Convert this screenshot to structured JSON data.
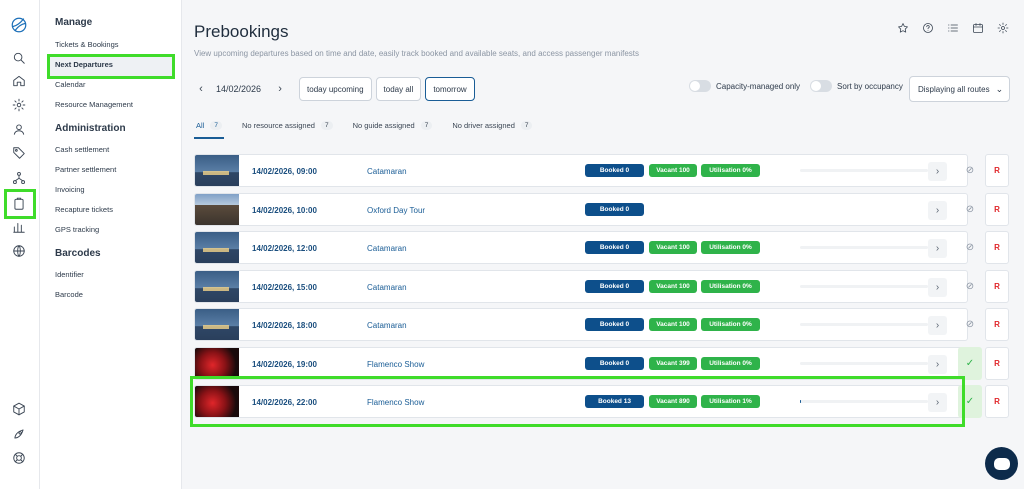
{
  "nav": {
    "sections": [
      {
        "title": "Manage",
        "items": [
          "Tickets & Bookings",
          "Next Departures",
          "Calendar",
          "Resource Management"
        ]
      },
      {
        "title": "Administration",
        "items": [
          "Cash settlement",
          "Partner settlement",
          "Invoicing",
          "Recapture tickets",
          "GPS tracking"
        ]
      },
      {
        "title": "Barcodes",
        "items": [
          "Identifier",
          "Barcode"
        ]
      }
    ],
    "active_item": "Next Departures"
  },
  "rail_icons": [
    "logo-icon",
    "search-icon",
    "home-icon",
    "gear-icon",
    "user-icon",
    "tag-icon",
    "network-icon",
    "clipboard-icon",
    "bar-chart-icon",
    "globe-icon",
    "box-icon",
    "rocket-icon",
    "lifebuoy-icon"
  ],
  "header": {
    "title": "Prebookings",
    "subtitle": "View upcoming departures based on time and date, easily track booked and available seats, and access passenger manifests",
    "icons": [
      "star-icon",
      "help-icon",
      "list-icon",
      "calendar-icon",
      "gear-icon"
    ]
  },
  "filters": {
    "date": "14/02/2026",
    "quick": [
      "today upcoming",
      "today all",
      "tomorrow"
    ],
    "selected_quick": "tomorrow",
    "capacity_label": "Capacity-managed only",
    "capacity_on": false,
    "occupancy_label": "Sort by occupancy",
    "occupancy_on": false,
    "routes_label": "Displaying all routes"
  },
  "tabs": [
    {
      "label": "All",
      "count": "7"
    },
    {
      "label": "No resource assigned",
      "count": "7"
    },
    {
      "label": "No guide assigned",
      "count": "7"
    },
    {
      "label": "No driver assigned",
      "count": "7"
    }
  ],
  "departures": [
    {
      "datetime": "14/02/2026, 09:00",
      "name": "Catamaran",
      "booked": "Booked 0",
      "vacant": "Vacant 100",
      "utilisation": "Utilisation 0%",
      "util_pct": 0,
      "image": "catamaran",
      "status": "ban"
    },
    {
      "datetime": "14/02/2026, 10:00",
      "name": "Oxford Day Tour",
      "booked": "Booked 0",
      "vacant": "",
      "utilisation": "",
      "util_pct": null,
      "image": "tour",
      "status": "ban"
    },
    {
      "datetime": "14/02/2026, 12:00",
      "name": "Catamaran",
      "booked": "Booked 0",
      "vacant": "Vacant 100",
      "utilisation": "Utilisation 0%",
      "util_pct": 0,
      "image": "catamaran",
      "status": "ban"
    },
    {
      "datetime": "14/02/2026, 15:00",
      "name": "Catamaran",
      "booked": "Booked 0",
      "vacant": "Vacant 100",
      "utilisation": "Utilisation 0%",
      "util_pct": 0,
      "image": "catamaran",
      "status": "ban"
    },
    {
      "datetime": "14/02/2026, 18:00",
      "name": "Catamaran",
      "booked": "Booked 0",
      "vacant": "Vacant 100",
      "utilisation": "Utilisation 0%",
      "util_pct": 0,
      "image": "catamaran",
      "status": "ban"
    },
    {
      "datetime": "14/02/2026, 19:00",
      "name": "Flamenco Show",
      "booked": "Booked 0",
      "vacant": "Vacant 399",
      "utilisation": "Utilisation 0%",
      "util_pct": 0,
      "image": "flamenco",
      "status": "ok"
    },
    {
      "datetime": "14/02/2026, 22:00",
      "name": "Flamenco Show",
      "booked": "Booked 13",
      "vacant": "Vacant 890",
      "utilisation": "Utilisation 1%",
      "util_pct": 1,
      "image": "flamenco",
      "status": "ok"
    }
  ],
  "row_button": "R",
  "colors": {
    "primary": "#0d4f8b",
    "success": "#2fb34a",
    "danger": "#e0262a",
    "highlight": "#3fdc2a"
  }
}
